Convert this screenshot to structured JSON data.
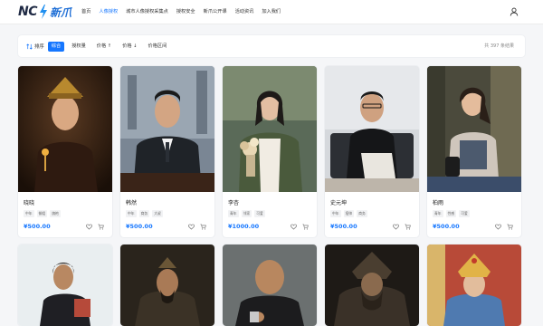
{
  "brand": {
    "logo_mark": "NC",
    "logo_cn": "新爪"
  },
  "nav": {
    "items": [
      {
        "label": "首页",
        "active": false
      },
      {
        "label": "人像授权",
        "active": true
      },
      {
        "label": "城市人像授权采集点",
        "active": false
      },
      {
        "label": "授权安全",
        "active": false
      },
      {
        "label": "新爪公开课",
        "active": false
      },
      {
        "label": "活动资讯",
        "active": false
      },
      {
        "label": "加入我们",
        "active": false
      }
    ]
  },
  "filter": {
    "sort_label": "排序",
    "chips": [
      {
        "label": "综合",
        "active": true
      },
      {
        "label": "授权量",
        "active": false
      },
      {
        "label": "价格 ↑",
        "active": false
      },
      {
        "label": "价格 ↓",
        "active": false
      },
      {
        "label": "价格区间",
        "active": false
      }
    ],
    "result_count": "共 397 条结果"
  },
  "cards": [
    {
      "name": "晓晓",
      "tags": [
        "中年",
        "御姐",
        "旗袍"
      ],
      "price": "¥500.00",
      "photo": "woman-qing-dynasty-costume"
    },
    {
      "name": "韩然",
      "tags": [
        "中年",
        "商务",
        "大叔"
      ],
      "price": "¥500.00",
      "photo": "man-business-suit"
    },
    {
      "name": "李杏",
      "tags": [
        "青年",
        "邻家",
        "可爱"
      ],
      "price": "¥1000.00",
      "photo": "woman-with-flowers"
    },
    {
      "name": "史元坤",
      "tags": [
        "中年",
        "痞帅",
        "商务"
      ],
      "price": "¥500.00",
      "photo": "man-black-polo-sofa"
    },
    {
      "name": "柏雨",
      "tags": [
        "青年",
        "性感",
        "可爱"
      ],
      "price": "¥500.00",
      "photo": "woman-street-fashion"
    },
    {
      "photo": "woman-ethnic-costume"
    },
    {
      "photo": "man-ancient-warrior"
    },
    {
      "photo": "bald-man-pointing"
    },
    {
      "photo": "man-dark-armor"
    },
    {
      "photo": "woman-golden-crown"
    }
  ],
  "colors": {
    "accent": "#1677ff",
    "price": "#1677ff"
  },
  "icons": {
    "user": "user-icon",
    "sort": "sort-icon",
    "favorite": "heart-icon",
    "cart": "cart-icon"
  }
}
